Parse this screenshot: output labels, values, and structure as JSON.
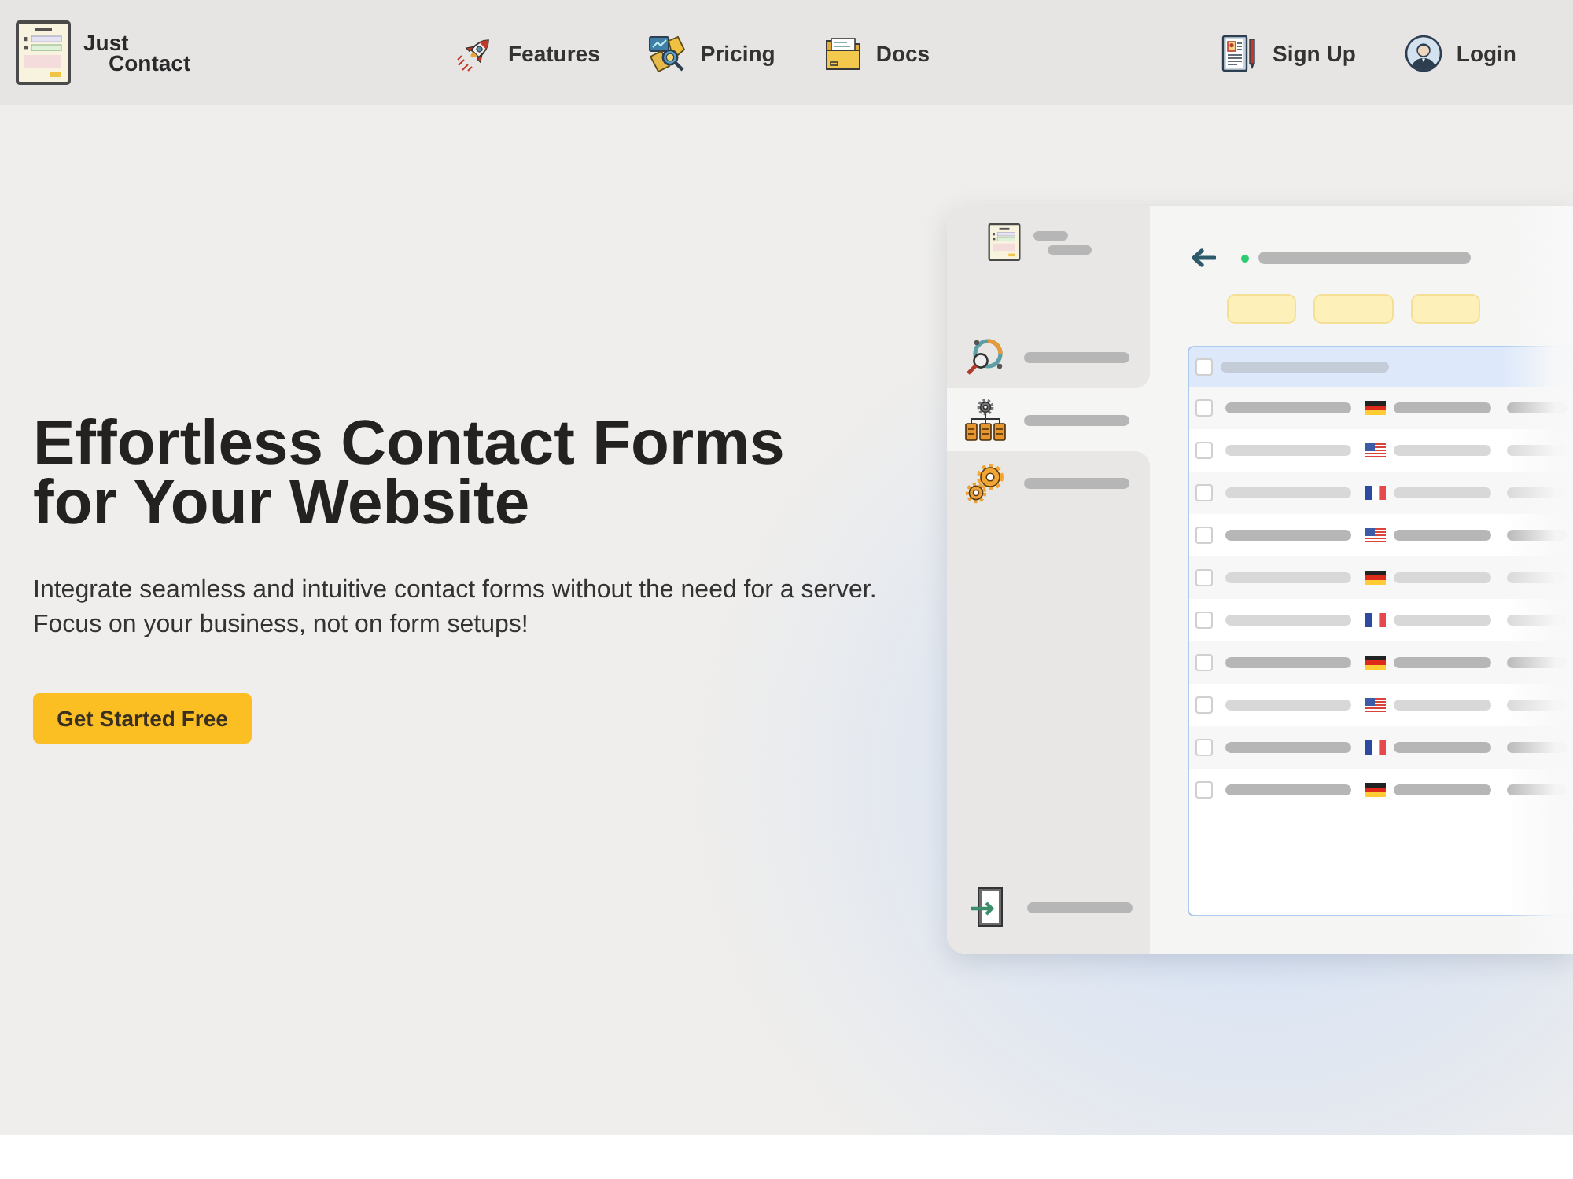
{
  "header": {
    "brand": [
      "Just",
      "Contact"
    ],
    "nav": [
      {
        "kind": "rocket",
        "label": "Features"
      },
      {
        "kind": "pricing",
        "label": "Pricing"
      },
      {
        "kind": "folder",
        "label": "Docs"
      }
    ],
    "account": [
      {
        "kind": "signup",
        "label": "Sign Up"
      },
      {
        "kind": "avatar",
        "label": "Login"
      }
    ]
  },
  "hero": {
    "title": "Effortless Contact Forms for Your Website",
    "description": "Integrate seamless and intuitive contact forms without the need for a server. Focus on your business, not on form setups!",
    "button": "Get Started Free"
  },
  "app_preview": {
    "sidebar": {
      "items": [
        {
          "kind": "analytics",
          "selected": false
        },
        {
          "kind": "hierarchy",
          "selected": true
        },
        {
          "kind": "gears",
          "selected": false
        }
      ]
    },
    "table": {
      "header": {
        "checked": false
      },
      "rows": [
        {
          "kind": "germany",
          "checked": false,
          "faded": false
        },
        {
          "kind": "usa",
          "checked": false,
          "faded": true
        },
        {
          "kind": "france",
          "checked": false,
          "faded": true
        },
        {
          "kind": "usa",
          "checked": false,
          "faded": false
        },
        {
          "kind": "germany",
          "checked": false,
          "faded": true
        },
        {
          "kind": "france",
          "checked": false,
          "faded": true
        },
        {
          "kind": "germany",
          "checked": false,
          "faded": false
        },
        {
          "kind": "usa",
          "checked": false,
          "faded": true
        },
        {
          "kind": "france",
          "checked": false,
          "faded": false
        },
        {
          "kind": "germany",
          "checked": false,
          "faded": false
        }
      ]
    }
  }
}
